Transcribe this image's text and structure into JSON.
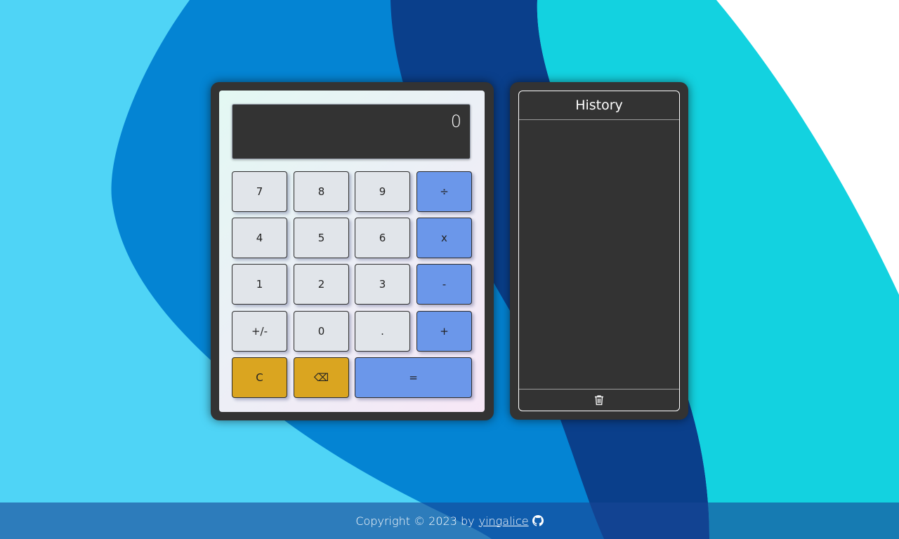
{
  "colors": {
    "background_light": "#4fd4f6",
    "background_blue": "#0484d3",
    "background_navy": "#0a3f8b",
    "background_teal": "#13d2e0",
    "panel_dark": "#333333",
    "key_default": "#e1e5ea",
    "key_operator": "#6b97ea",
    "key_function": "#daa520"
  },
  "calculator": {
    "display": "0",
    "keys": [
      {
        "id": "7",
        "label": "7",
        "type": "number"
      },
      {
        "id": "8",
        "label": "8",
        "type": "number"
      },
      {
        "id": "9",
        "label": "9",
        "type": "number"
      },
      {
        "id": "divide",
        "label": "÷",
        "type": "operator"
      },
      {
        "id": "4",
        "label": "4",
        "type": "number"
      },
      {
        "id": "5",
        "label": "5",
        "type": "number"
      },
      {
        "id": "6",
        "label": "6",
        "type": "number"
      },
      {
        "id": "multiply",
        "label": "x",
        "type": "operator"
      },
      {
        "id": "1",
        "label": "1",
        "type": "number"
      },
      {
        "id": "2",
        "label": "2",
        "type": "number"
      },
      {
        "id": "3",
        "label": "3",
        "type": "number"
      },
      {
        "id": "subtract",
        "label": "-",
        "type": "operator"
      },
      {
        "id": "negate",
        "label": "+/-",
        "type": "number"
      },
      {
        "id": "0",
        "label": "0",
        "type": "number"
      },
      {
        "id": "decimal",
        "label": ".",
        "type": "number"
      },
      {
        "id": "add",
        "label": "+",
        "type": "operator"
      },
      {
        "id": "clear",
        "label": "C",
        "type": "function"
      },
      {
        "id": "backspace",
        "label": "⌫",
        "type": "function"
      },
      {
        "id": "equals",
        "label": "=",
        "type": "operator"
      }
    ]
  },
  "history": {
    "title": "History",
    "entries": [],
    "clear_icon": "trash-icon"
  },
  "footer": {
    "text": "Copyright © 2023 by",
    "author": "yingalice",
    "icon": "github-icon"
  }
}
